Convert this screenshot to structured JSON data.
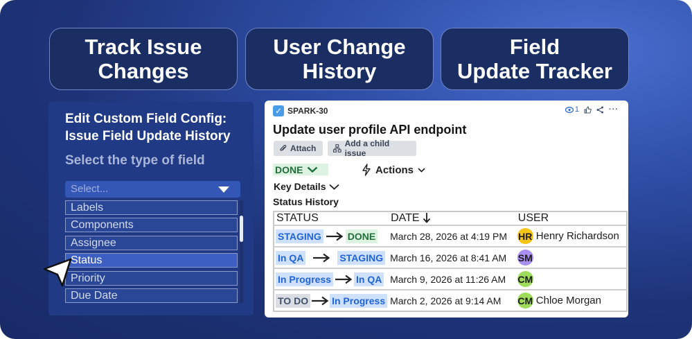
{
  "pills": [
    {
      "line1": "Track Issue",
      "line2": "Changes"
    },
    {
      "line1": "User Change",
      "line2": "History"
    },
    {
      "line1": "Field",
      "line2": "Update Tracker"
    }
  ],
  "config": {
    "title_line1": "Edit Custom Field Config:",
    "title_line2": "Issue Field Update History",
    "subtitle": "Select the type of field",
    "select_placeholder": "Select...",
    "options": [
      "Labels",
      "Components",
      "Assignee",
      "Status",
      "Priority",
      "Due Date"
    ],
    "selected_option": "Status"
  },
  "issue": {
    "key": "SPARK-30",
    "watchers": "1",
    "title": "Update user profile API endpoint",
    "attach_label": "Attach",
    "child_issue_label": "Add a child issue",
    "status": "DONE",
    "actions_label": "Actions",
    "key_details_label": "Key Details",
    "status_history_label": "Status History"
  },
  "history": {
    "columns": {
      "status": "STATUS",
      "date": "DATE",
      "user": "USER"
    },
    "rows": [
      {
        "from": "STAGING",
        "to": "DONE",
        "date": "March 28, 2026 at 4:19 PM",
        "initials": "HR",
        "user": "Henry Richardson",
        "avatar_color": "#f5c518"
      },
      {
        "from": "In QA",
        "to": "STAGING",
        "date": "March 16, 2026 at 8:41 AM",
        "initials": "SM",
        "user": "",
        "avatar_color": "#a88ff0"
      },
      {
        "from": "In Progress",
        "to": "In QA",
        "date": "March 9, 2026 at 11:26 AM",
        "initials": "CM",
        "user": "",
        "avatar_color": "#9fdc5c"
      },
      {
        "from": "TO DO",
        "to": "In Progress",
        "date": "March 2, 2026 at 9:14 AM",
        "initials": "CM",
        "user": "Chloe Morgan",
        "avatar_color": "#9fdc5c"
      }
    ]
  },
  "colors": {
    "background": "#1e3479",
    "card": "#ffffff",
    "done_green": "#216e3a",
    "status_blue": "#1f63d6"
  }
}
